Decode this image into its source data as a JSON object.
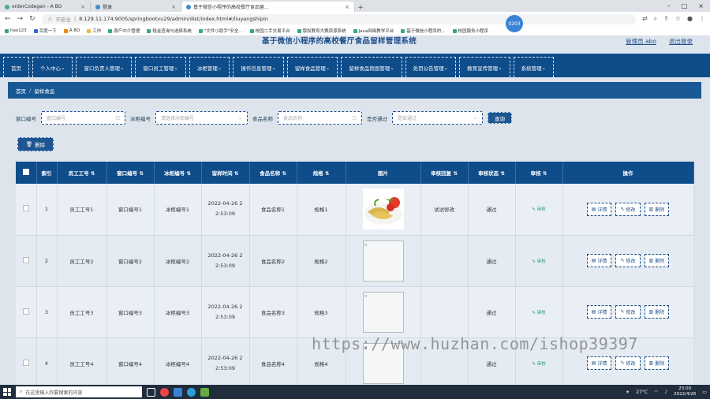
{
  "browser": {
    "tabs": [
      {
        "label": "orderCodegen - A BO"
      },
      {
        "label": "登录"
      },
      {
        "label": "基于微信小程序的高校餐厅食品留..."
      }
    ],
    "url_insecure": "不安全",
    "url": "8.129.11.174:9005/springbootvu29/admin/dist/index.html#/liuyangshipin",
    "bookmarks": [
      "hao123",
      "百度一下",
      "A BO",
      "工作",
      "原产中介管理",
      "租金查询与选择系统",
      "\"文件小助手\"安全...",
      "校园二手交易平台",
      "版权教育大赛资源系统",
      "Java网络教学平台",
      "基于微信小程序的...",
      "校园服务小程序"
    ]
  },
  "badge": "0203",
  "header": {
    "title": "基于微信小程序的高校餐厅食品留样管理系统",
    "user": "管理员 abo",
    "logout": "退出登录"
  },
  "nav": [
    "首页",
    "个人中心",
    "窗口负责人管理",
    "窗口员工管理",
    "冰柜管理",
    "操作信息管理",
    "留样食品管理",
    "留样食品销毁管理",
    "处罚公告管理",
    "教育宣传管理",
    "系统管理"
  ],
  "breadcrumb": {
    "home": "首页",
    "current": "留样食品"
  },
  "filters": {
    "window_no_label": "窗口编号",
    "window_no_placeholder": "窗口编号",
    "freezer_no_label": "冰柜编号",
    "freezer_no_placeholder": "请选择冰柜编号",
    "food_name_label": "食品名称",
    "food_name_placeholder": "食品名称",
    "approved_label": "是否通过",
    "approved_placeholder": "是否通过",
    "query_button": "查询"
  },
  "delete_button": "删除",
  "table": {
    "headers": [
      "索引",
      "员工工号",
      "窗口编号",
      "冰柜编号",
      "留样时间",
      "食品名称",
      "规格",
      "图片",
      "审核回复",
      "审核状态",
      "审核",
      "操作"
    ],
    "rows": [
      {
        "index": "1",
        "staff": "员工工号1",
        "window": "窗口编号1",
        "freezer": "冰柜编号1",
        "date": "2022-04-26 2",
        "time": "2:53:09",
        "food": "食品名称1",
        "spec": "规格1",
        "reply": "试试修改",
        "status": "通过",
        "audit": "审核",
        "hasImage": true
      },
      {
        "index": "2",
        "staff": "员工工号2",
        "window": "窗口编号2",
        "freezer": "冰柜编号2",
        "date": "2022-04-26 2",
        "time": "2:53:09",
        "food": "食品名称2",
        "spec": "规格2",
        "reply": "",
        "status": "通过",
        "audit": "审核",
        "hasImage": false
      },
      {
        "index": "3",
        "staff": "员工工号3",
        "window": "窗口编号3",
        "freezer": "冰柜编号3",
        "date": "2022-04-26 2",
        "time": "2:53:09",
        "food": "食品名称3",
        "spec": "规格3",
        "reply": "",
        "status": "通过",
        "audit": "审核",
        "hasImage": false
      },
      {
        "index": "4",
        "staff": "员工工号4",
        "window": "窗口编号4",
        "freezer": "冰柜编号4",
        "date": "2022-04-26 2",
        "time": "2:53:09",
        "food": "食品名称4",
        "spec": "规格4",
        "reply": "",
        "status": "通过",
        "audit": "审核",
        "hasImage": false
      }
    ],
    "op_detail": "详情",
    "op_edit": "修改",
    "op_delete": "删除"
  },
  "watermark": "https://www.huzhan.com/ishop39397",
  "taskbar": {
    "search_placeholder": "在这里输入你要搜索的内容",
    "temp": "27°C",
    "time": "23:00",
    "date": "2022/4/26"
  }
}
